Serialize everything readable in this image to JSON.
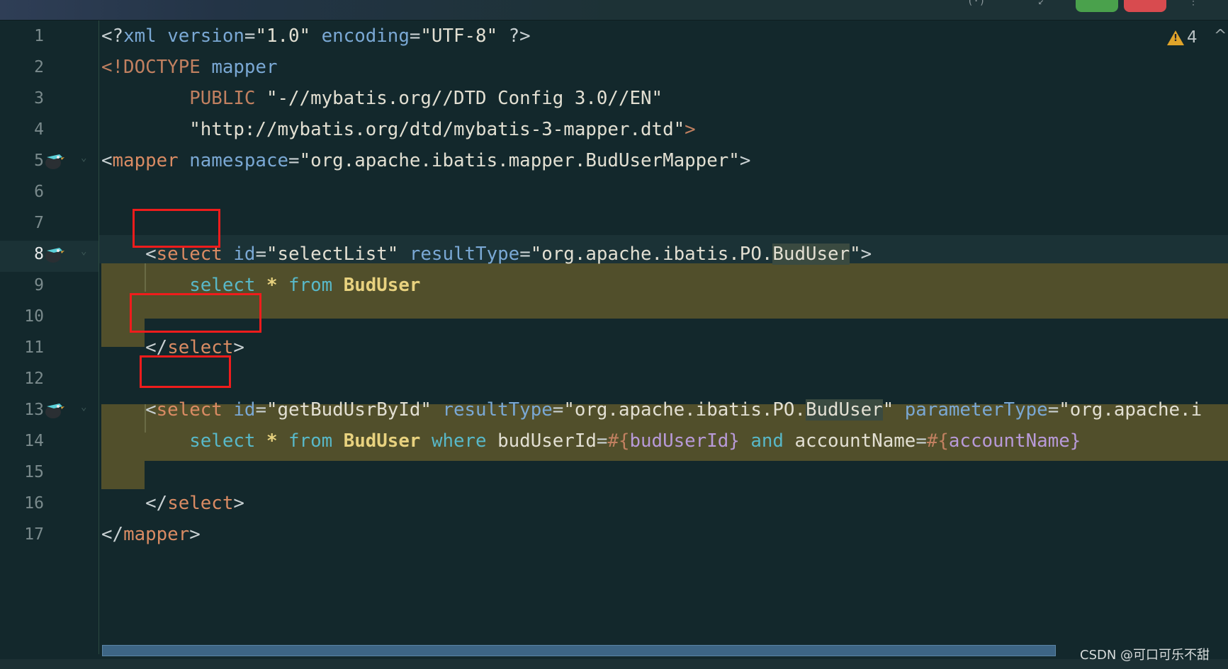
{
  "editor": {
    "line_numbers": [
      "1",
      "2",
      "3",
      "4",
      "5",
      "6",
      "7",
      "8",
      "9",
      "10",
      "11",
      "12",
      "13",
      "14",
      "15",
      "16",
      "17"
    ],
    "current_line": "8",
    "lines": [
      [
        [
          "<?",
          "t-punc"
        ],
        [
          "xml",
          "t-attr"
        ],
        [
          " ",
          "t-punc"
        ],
        [
          "version",
          "t-attr"
        ],
        [
          "=",
          "t-punc"
        ],
        [
          "\"1.0\"",
          "t-val"
        ],
        [
          " ",
          "t-punc"
        ],
        [
          "encoding",
          "t-attr"
        ],
        [
          "=",
          "t-punc"
        ],
        [
          "\"UTF-8\"",
          "t-val"
        ],
        [
          " ?>",
          "t-punc"
        ]
      ],
      [
        [
          "<!DOCTYPE",
          "t-dim"
        ],
        [
          " ",
          "t-punc"
        ],
        [
          "mapper",
          "t-attr"
        ]
      ],
      [
        [
          "        ",
          "t-punc"
        ],
        [
          "PUBLIC",
          "t-dim"
        ],
        [
          " ",
          "t-punc"
        ],
        [
          "\"-//mybatis.org//DTD Config 3.0//EN\"",
          "t-val"
        ]
      ],
      [
        [
          "        ",
          "t-punc"
        ],
        [
          "\"http://mybatis.org/dtd/mybatis-3-mapper.dtd\"",
          "t-val"
        ],
        [
          ">",
          "t-dim"
        ]
      ],
      [
        [
          "<",
          "t-punc"
        ],
        [
          "mapper",
          "t-tag"
        ],
        [
          " ",
          "t-punc"
        ],
        [
          "namespace",
          "t-attr"
        ],
        [
          "=",
          "t-punc"
        ],
        [
          "\"org.apache.ibatis.mapper.BudUserMapper\"",
          "t-val"
        ],
        [
          ">",
          "t-punc"
        ]
      ],
      [],
      [],
      [
        [
          "    ",
          "t-punc"
        ],
        [
          "<",
          "t-punc"
        ],
        [
          "select",
          "t-tag"
        ],
        [
          " ",
          "t-punc"
        ],
        [
          "id",
          "t-attr"
        ],
        [
          "=",
          "t-punc"
        ],
        [
          "\"selectList\"",
          "t-val"
        ],
        [
          " ",
          "t-punc"
        ],
        [
          "resultType",
          "t-attr"
        ],
        [
          "=",
          "t-punc"
        ],
        [
          "\"org.apache.ibatis.PO.",
          "t-val"
        ],
        [
          "BudUser",
          "t-val t-ref"
        ],
        [
          "\"",
          "t-val"
        ],
        [
          ">",
          "t-punc"
        ]
      ],
      [
        [
          "        ",
          "t-punc"
        ],
        [
          "select",
          "t-kw"
        ],
        [
          " ",
          "t-punc"
        ],
        [
          "*",
          "t-ident"
        ],
        [
          " ",
          "t-punc"
        ],
        [
          "from",
          "t-kw"
        ],
        [
          " ",
          "t-punc"
        ],
        [
          "BudUser",
          "t-ident"
        ]
      ],
      [],
      [
        [
          "    ",
          "t-punc"
        ],
        [
          "</",
          "t-punc"
        ],
        [
          "select",
          "t-tag"
        ],
        [
          ">",
          "t-punc"
        ]
      ],
      [],
      [
        [
          "    ",
          "t-punc"
        ],
        [
          "<",
          "t-punc"
        ],
        [
          "select",
          "t-tag"
        ],
        [
          " ",
          "t-punc"
        ],
        [
          "id",
          "t-attr"
        ],
        [
          "=",
          "t-punc"
        ],
        [
          "\"getBudUsrById\"",
          "t-val"
        ],
        [
          " ",
          "t-punc"
        ],
        [
          "resultType",
          "t-attr"
        ],
        [
          "=",
          "t-punc"
        ],
        [
          "\"org.apache.ibatis.PO.",
          "t-val"
        ],
        [
          "BudUser",
          "t-val t-ref"
        ],
        [
          "\"",
          "t-val"
        ],
        [
          " ",
          "t-punc"
        ],
        [
          "parameterType",
          "t-attr"
        ],
        [
          "=",
          "t-punc"
        ],
        [
          "\"org.apache.i",
          "t-val"
        ]
      ],
      [
        [
          "        ",
          "t-punc"
        ],
        [
          "select",
          "t-kw"
        ],
        [
          " ",
          "t-punc"
        ],
        [
          "*",
          "t-ident"
        ],
        [
          " ",
          "t-punc"
        ],
        [
          "from",
          "t-kw"
        ],
        [
          " ",
          "t-punc"
        ],
        [
          "BudUser",
          "t-ident"
        ],
        [
          " ",
          "t-punc"
        ],
        [
          "where",
          "t-kw"
        ],
        [
          " ",
          "t-punc"
        ],
        [
          "budUserId",
          "t-val"
        ],
        [
          "=",
          "t-punc"
        ],
        [
          "#{",
          "t-dim"
        ],
        [
          "budUserId",
          "t-param"
        ],
        [
          "}",
          "t-param"
        ],
        [
          " ",
          "t-punc"
        ],
        [
          "and",
          "t-kw"
        ],
        [
          " ",
          "t-punc"
        ],
        [
          "accountName",
          "t-val"
        ],
        [
          "=",
          "t-punc"
        ],
        [
          "#{",
          "t-dim"
        ],
        [
          "accountName",
          "t-param"
        ],
        [
          "}",
          "t-param"
        ]
      ],
      [],
      [
        [
          "    ",
          "t-punc"
        ],
        [
          "</",
          "t-punc"
        ],
        [
          "select",
          "t-tag"
        ],
        [
          ">",
          "t-punc"
        ]
      ],
      [
        [
          "</",
          "t-punc"
        ],
        [
          "mapper",
          "t-tag"
        ],
        [
          ">",
          "t-punc"
        ]
      ]
    ]
  },
  "inspections": {
    "warning_count": "4",
    "warning_icon": "warning-triangle-icon",
    "nav_icon": "chevron-up-icon"
  },
  "watermark": "CSDN @可口可乐不甜",
  "colors": {
    "background": "#13282c",
    "injected_highlight": "#514f2b",
    "annotation_red": "#ef1c1c"
  }
}
